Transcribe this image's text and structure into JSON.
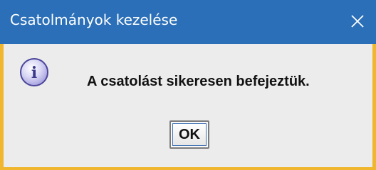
{
  "window": {
    "title": "Csatolmányok kezelése",
    "close_icon": "close-icon",
    "titlebar_color": "#2a6fb8",
    "frame_color": "#efb62e"
  },
  "dialog": {
    "icon": "info-icon",
    "icon_glyph": "i",
    "message": "A csatolást sikeresen befejeztük.",
    "ok_label": "OK",
    "background_color": "#ececec"
  }
}
